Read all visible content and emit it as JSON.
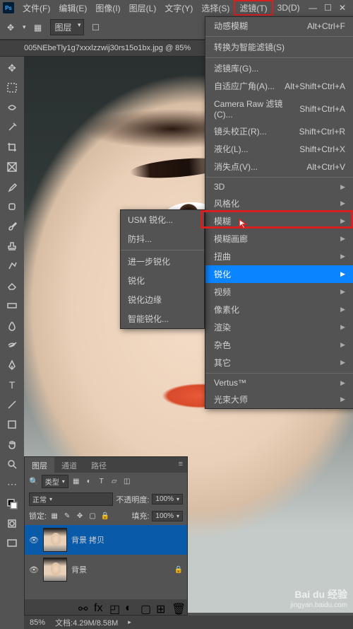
{
  "title_menu": [
    "文件(F)",
    "编辑(E)",
    "图像(I)",
    "图层(L)",
    "文字(Y)",
    "选择(S)",
    "滤镜(T)",
    "3D(D)"
  ],
  "winctl": [
    "—",
    "☐",
    "✕"
  ],
  "opt": {
    "layer": "图层"
  },
  "tab": "005NEbeTly1g7xxxlzzwij30rs15o1bx.jpg @ 85%",
  "sub1": [
    "USM 锐化...",
    "防抖...",
    "进一步锐化",
    "锐化",
    "锐化边缘",
    "智能锐化..."
  ],
  "menu2": {
    "top": {
      "label": "动感模糊",
      "sc": "Alt+Ctrl+F"
    },
    "conv": "转换为智能滤镜(S)",
    "g1": [
      {
        "l": "滤镜库(G)...",
        "s": ""
      },
      {
        "l": "自适应广角(A)...",
        "s": "Alt+Shift+Ctrl+A"
      },
      {
        "l": "Camera Raw 滤镜(C)...",
        "s": "Shift+Ctrl+A"
      },
      {
        "l": "镜头校正(R)...",
        "s": "Shift+Ctrl+R"
      },
      {
        "l": "液化(L)...",
        "s": "Shift+Ctrl+X"
      },
      {
        "l": "消失点(V)...",
        "s": "Alt+Ctrl+V"
      }
    ],
    "g2": [
      "3D",
      "风格化",
      "模糊",
      "模糊画廊",
      "扭曲",
      "锐化",
      "视频",
      "像素化",
      "渲染",
      "杂色",
      "其它"
    ],
    "g3": [
      "Vertus™",
      "光束大师"
    ]
  },
  "panel": {
    "tabs": [
      "图层",
      "通道",
      "路径"
    ],
    "kind": "类型",
    "mode": "正常",
    "opacity_l": "不透明度:",
    "opacity_v": "100%",
    "lock": "锁定:",
    "fill_l": "填充:",
    "fill_v": "100%",
    "layers": [
      {
        "name": "背景 拷贝"
      },
      {
        "name": "背景"
      }
    ]
  },
  "status": {
    "zoom": "85%",
    "doc": "文档:4.29M/8.58M"
  },
  "wm": {
    "brand": "Bai du 经验",
    "url": "jingyan.baidu.com"
  }
}
